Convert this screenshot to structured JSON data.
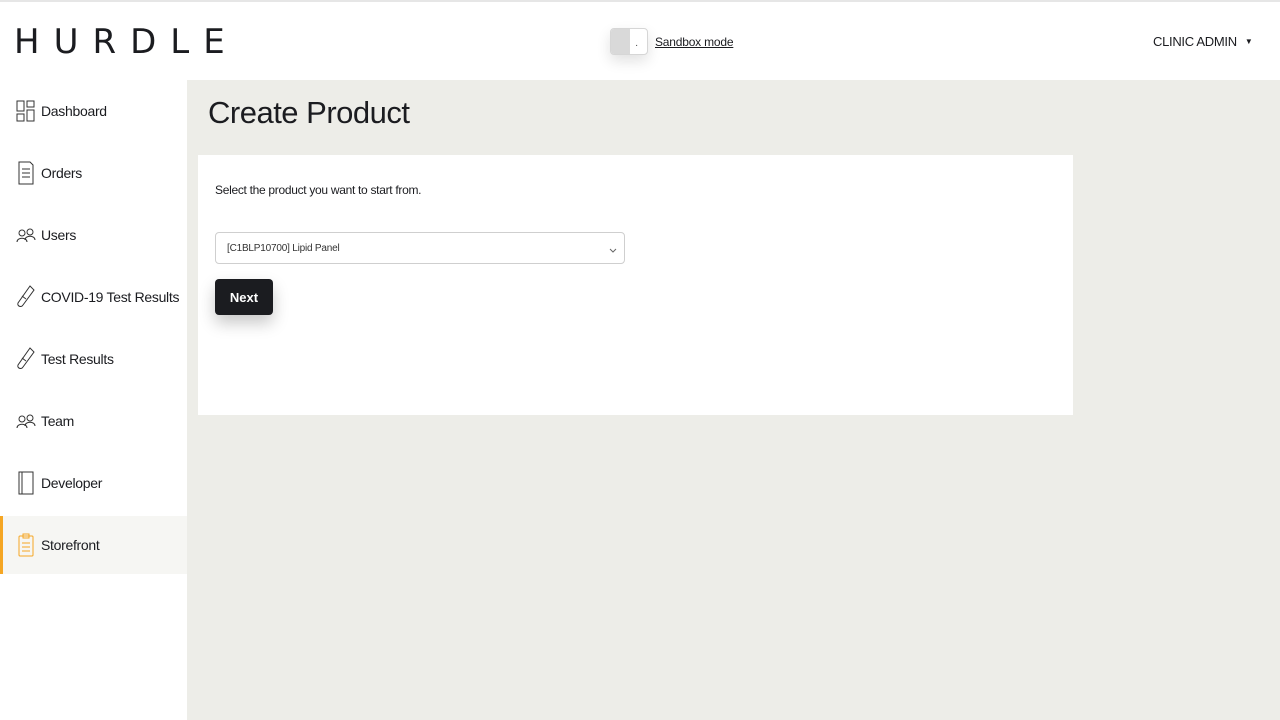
{
  "header": {
    "logo": "HURDLE",
    "sandbox_label": "Sandbox mode",
    "toggle_mark": ".",
    "user_menu_label": "CLINIC ADMIN",
    "user_menu_caret": "▼"
  },
  "sidebar": {
    "items": [
      {
        "label": "Dashboard",
        "icon": "dashboard-icon"
      },
      {
        "label": "Orders",
        "icon": "orders-icon"
      },
      {
        "label": "Users",
        "icon": "users-icon"
      },
      {
        "label": "COVID-19 Test Results",
        "icon": "test-tube-icon"
      },
      {
        "label": "Test Results",
        "icon": "test-tube-icon"
      },
      {
        "label": "Team",
        "icon": "team-icon"
      },
      {
        "label": "Developer",
        "icon": "developer-icon"
      },
      {
        "label": "Storefront",
        "icon": "clipboard-icon",
        "active": true
      }
    ]
  },
  "main": {
    "title": "Create Product",
    "instruction": "Select the product you want to start from.",
    "selected_product": "[C1BLP10700] Lipid Panel",
    "next_label": "Next"
  },
  "colors": {
    "accent": "#f5a623",
    "button": "#1b1c20",
    "background": "#edede8"
  }
}
